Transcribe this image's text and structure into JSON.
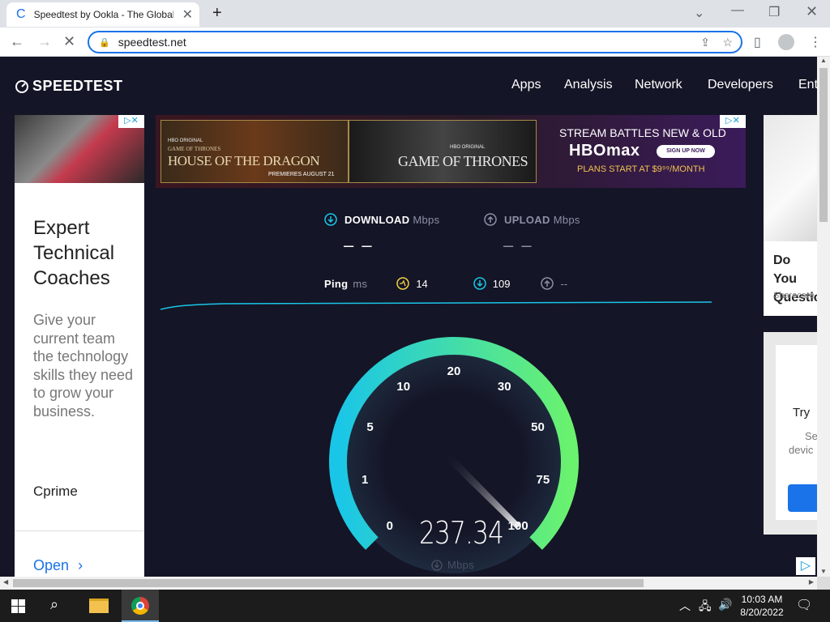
{
  "browser": {
    "tab_title": "Speedtest by Ookla - The Global",
    "url": "speedtest.net"
  },
  "nav": {
    "logo": "SPEEDTEST",
    "items": [
      "Apps",
      "Analysis",
      "Network",
      "Developers",
      "Ent"
    ]
  },
  "left_ad": {
    "title": "Expert Technical Coaches",
    "body": "Give your current team the technology skills they need to grow your business.",
    "brand": "Cprime",
    "cta": "Open"
  },
  "banner_ad": {
    "hbo_original_1": "HBO ORIGINAL",
    "got_small": "GAME OF THRONES",
    "hotd": "HOUSE OF THE DRAGON",
    "premieres": "PREMIERES AUGUST 21",
    "hbo_original_2": "HBO ORIGINAL",
    "got": "GAME OF THRONES",
    "headline": "STREAM BATTLES NEW & OLD",
    "brand": "HBOmax",
    "signup": "SIGN UP NOW",
    "plans": "PLANS START AT $9⁹⁹/MONTH"
  },
  "right_ad": {
    "title": "Do You Questic",
    "source": "Sharecare",
    "try": "Try",
    "se": "Se",
    "devic": "devic"
  },
  "results": {
    "download_label": "DOWNLOAD",
    "download_unit": "Mbps",
    "download_value": "– –",
    "upload_label": "UPLOAD",
    "upload_unit": "Mbps",
    "upload_value": "– –",
    "ping_label": "Ping",
    "ping_unit": "ms",
    "ping_value": "14",
    "download_latency": "109",
    "upload_latency": "--"
  },
  "gauge": {
    "ticks": [
      "0",
      "1",
      "5",
      "10",
      "20",
      "30",
      "50",
      "75",
      "100"
    ],
    "value": "237.34",
    "unit": "Mbps",
    "fill_fraction": 1.0
  },
  "taskbar": {
    "time": "10:03 AM",
    "date": "8/20/2022"
  },
  "colors": {
    "accent_cyan": "#1ac6e8",
    "accent_green": "#6af26e",
    "bg": "#141526"
  }
}
